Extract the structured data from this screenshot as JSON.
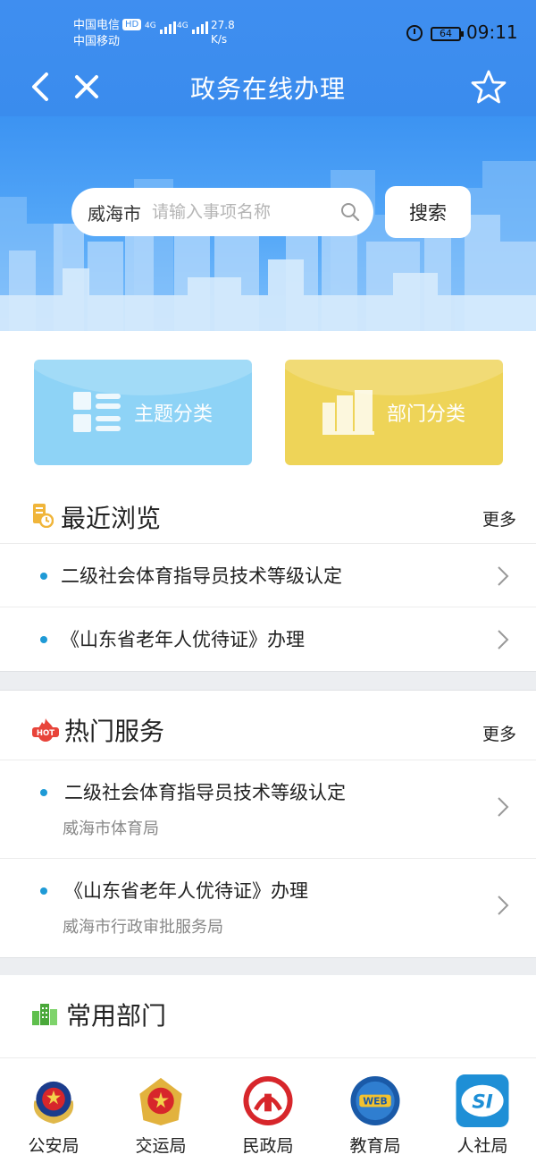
{
  "status_bar": {
    "carrier_1": "中国电信",
    "hd_badge": "HD",
    "carrier_2": "中国移动",
    "net_1": "4G",
    "net_2": "4G",
    "speed_value": "27.8",
    "speed_unit": "K/s",
    "battery": "64",
    "time": "09:11"
  },
  "header": {
    "title": "政务在线办理"
  },
  "search": {
    "city": "威海市",
    "placeholder": "请输入事项名称",
    "button_label": "搜索"
  },
  "categories": {
    "theme_label": "主题分类",
    "dept_label": "部门分类"
  },
  "recent": {
    "title": "最近浏览",
    "more": "更多",
    "items": [
      {
        "label": "二级社会体育指导员技术等级认定"
      },
      {
        "label": "《山东省老年人优待证》办理"
      }
    ]
  },
  "hot": {
    "title": "热门服务",
    "more": "更多",
    "items": [
      {
        "label": "二级社会体育指导员技术等级认定",
        "dept": "威海市体育局"
      },
      {
        "label": "《山东省老年人优待证》办理",
        "dept": "威海市行政审批服务局"
      }
    ]
  },
  "common_depts": {
    "title": "常用部门",
    "items": [
      {
        "name": "公安局",
        "icon": "police-emblem-icon"
      },
      {
        "name": "交运局",
        "icon": "transport-emblem-icon"
      },
      {
        "name": "民政局",
        "icon": "civil-affairs-logo-icon"
      },
      {
        "name": "教育局",
        "icon": "education-web-logo-icon"
      },
      {
        "name": "人社局",
        "icon": "social-security-logo-icon"
      }
    ]
  },
  "colors": {
    "header_blue": "#3a8ced",
    "theme_card": "#8ed3f6",
    "dept_card": "#eed458",
    "bullet": "#1e9ad6"
  }
}
